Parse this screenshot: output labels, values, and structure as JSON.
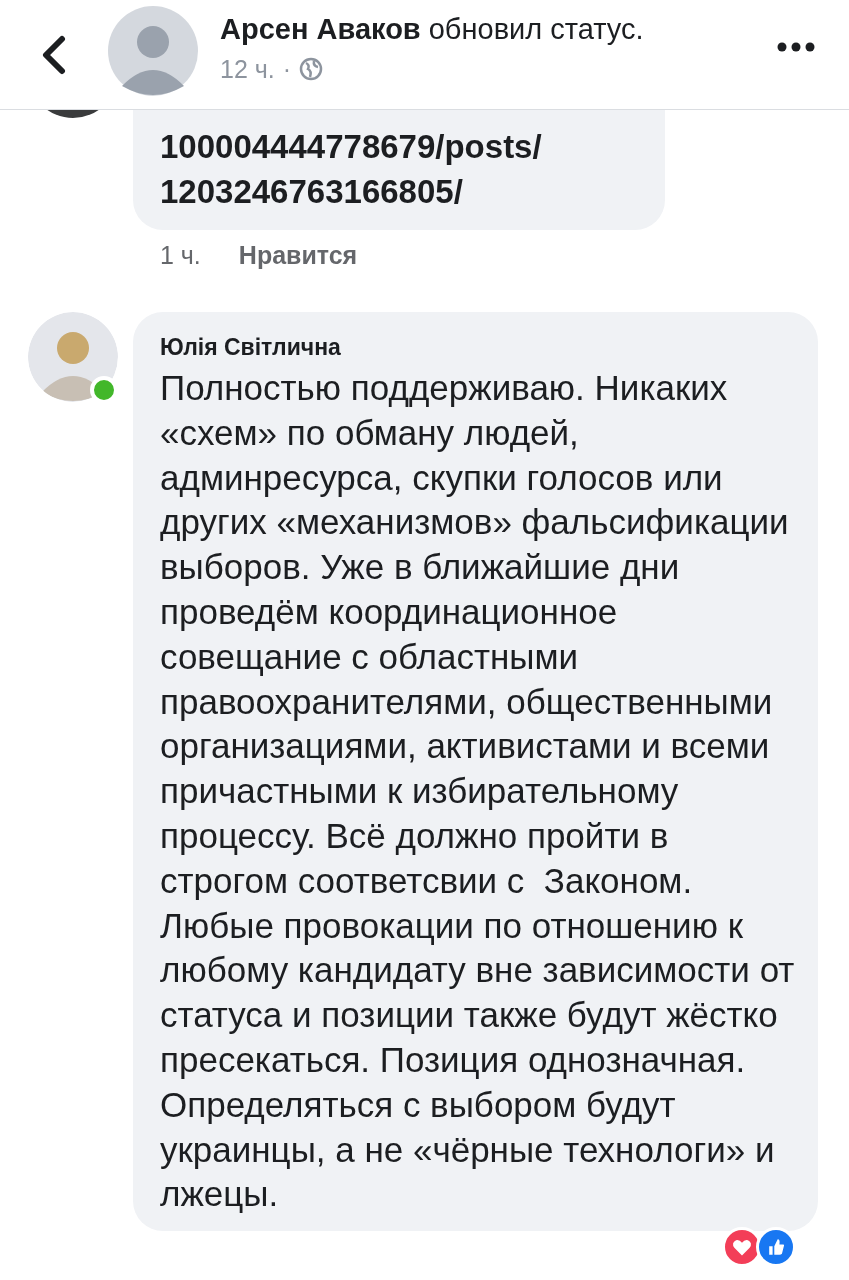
{
  "header": {
    "author": "Арсен Аваков",
    "action": "обновил статус.",
    "time": "12 ч.",
    "separator": "·"
  },
  "comments": [
    {
      "kind": "link",
      "text": "100004444778679/posts/\n1203246763166805/",
      "time": "1 ч.",
      "like": "Нравится"
    },
    {
      "kind": "text",
      "author": "Юлія Світлична",
      "online": true,
      "text": "Полностью поддерживаю. Никаких «схем» по обману людей, админресурса, скупки голосов или других «механизмов» фальсификации выборов. Уже в ближайшие дни  проведём координационное совещание с областными правоохранителями, общественными организациями, активистами и всеми причастными к избирательному процессу. Всё должно пройти в строгом соответсвии с  Законом. Любые провокации по отношению к любому кандидату вне зависимости от статуса и позиции также будут жёстко пресекаться. Позиция однозначная. Определяться с выбором будут украинцы, а не «чёрные технологи» и лжецы."
    }
  ]
}
